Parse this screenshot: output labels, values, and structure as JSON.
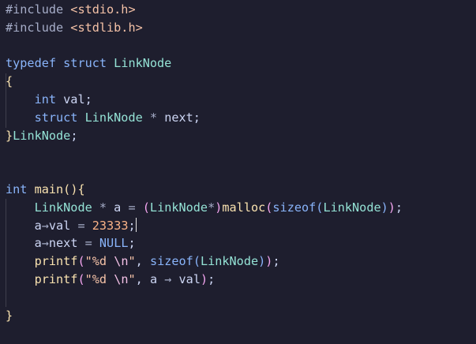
{
  "colors": {
    "background": "#1e1e2e",
    "preprocessor": "#a6adc8",
    "string": "#f5c2a7",
    "keyword": "#89b4fa",
    "type": "#94e2d5",
    "identifier": "#cdd6f4",
    "function": "#f9e2af",
    "number": "#fab387",
    "bracket_1": "#f9e2af",
    "bracket_2": "#f5a6f1",
    "bracket_3": "#89b4fa"
  },
  "editor": {
    "cursor_line": 12,
    "lines": [
      [
        {
          "t": "#include ",
          "c": "s-pre"
        },
        {
          "t": "<stdio.h>",
          "c": "s-str"
        }
      ],
      [
        {
          "t": "#include ",
          "c": "s-pre"
        },
        {
          "t": "<stdlib.h>",
          "c": "s-str"
        }
      ],
      [],
      [
        {
          "t": "typedef ",
          "c": "s-kw"
        },
        {
          "t": "struct ",
          "c": "s-kw"
        },
        {
          "t": "LinkNode",
          "c": "s-type"
        }
      ],
      [
        {
          "t": "{",
          "c": "s-brace1"
        }
      ],
      [
        {
          "t": "    "
        },
        {
          "t": "int ",
          "c": "s-kw"
        },
        {
          "t": "val",
          "c": "s-var"
        },
        {
          "t": ";",
          "c": "s-punc"
        }
      ],
      [
        {
          "t": "    "
        },
        {
          "t": "struct ",
          "c": "s-kw"
        },
        {
          "t": "LinkNode ",
          "c": "s-type"
        },
        {
          "t": "* ",
          "c": "s-op"
        },
        {
          "t": "next",
          "c": "s-var"
        },
        {
          "t": ";",
          "c": "s-punc"
        }
      ],
      [
        {
          "t": "}",
          "c": "s-brace1"
        },
        {
          "t": "LinkNode",
          "c": "s-type"
        },
        {
          "t": ";",
          "c": "s-punc"
        }
      ],
      [],
      [],
      [
        {
          "t": "int ",
          "c": "s-kw"
        },
        {
          "t": "main",
          "c": "s-fn"
        },
        {
          "t": "(",
          "c": "s-brace1"
        },
        {
          "t": ")",
          "c": "s-brace1"
        },
        {
          "t": "{",
          "c": "s-brace1"
        }
      ],
      [
        {
          "t": "    "
        },
        {
          "t": "LinkNode ",
          "c": "s-type"
        },
        {
          "t": "* ",
          "c": "s-op"
        },
        {
          "t": "a ",
          "c": "s-var"
        },
        {
          "t": "= ",
          "c": "s-op"
        },
        {
          "t": "(",
          "c": "s-brace2"
        },
        {
          "t": "LinkNode",
          "c": "s-type"
        },
        {
          "t": "*",
          "c": "s-op"
        },
        {
          "t": ")",
          "c": "s-brace2"
        },
        {
          "t": "malloc",
          "c": "s-fn"
        },
        {
          "t": "(",
          "c": "s-brace2"
        },
        {
          "t": "sizeof",
          "c": "s-kw"
        },
        {
          "t": "(",
          "c": "s-brace3"
        },
        {
          "t": "LinkNode",
          "c": "s-type"
        },
        {
          "t": ")",
          "c": "s-brace3"
        },
        {
          "t": ")",
          "c": "s-brace2"
        },
        {
          "t": ";",
          "c": "s-punc"
        }
      ],
      [
        {
          "t": "    "
        },
        {
          "t": "a",
          "c": "s-var"
        },
        {
          "t": "→",
          "c": "s-op"
        },
        {
          "t": "val ",
          "c": "s-var"
        },
        {
          "t": "= ",
          "c": "s-op"
        },
        {
          "t": "23333",
          "c": "s-num"
        },
        {
          "t": ";",
          "c": "s-punc"
        }
      ],
      [
        {
          "t": "    "
        },
        {
          "t": "a",
          "c": "s-var"
        },
        {
          "t": "→",
          "c": "s-op"
        },
        {
          "t": "next ",
          "c": "s-var"
        },
        {
          "t": "= ",
          "c": "s-op"
        },
        {
          "t": "NULL",
          "c": "s-const"
        },
        {
          "t": ";",
          "c": "s-punc"
        }
      ],
      [
        {
          "t": "    "
        },
        {
          "t": "printf",
          "c": "s-fn"
        },
        {
          "t": "(",
          "c": "s-brace2"
        },
        {
          "t": "\"%d ",
          "c": "s-str"
        },
        {
          "t": "\\n",
          "c": "s-esc"
        },
        {
          "t": "\"",
          "c": "s-str"
        },
        {
          "t": ", ",
          "c": "s-punc"
        },
        {
          "t": "sizeof",
          "c": "s-kw"
        },
        {
          "t": "(",
          "c": "s-brace3"
        },
        {
          "t": "LinkNode",
          "c": "s-type"
        },
        {
          "t": ")",
          "c": "s-brace3"
        },
        {
          "t": ")",
          "c": "s-brace2"
        },
        {
          "t": ";",
          "c": "s-punc"
        }
      ],
      [
        {
          "t": "    "
        },
        {
          "t": "printf",
          "c": "s-fn"
        },
        {
          "t": "(",
          "c": "s-brace2"
        },
        {
          "t": "\"%d ",
          "c": "s-str"
        },
        {
          "t": "\\n",
          "c": "s-esc"
        },
        {
          "t": "\"",
          "c": "s-str"
        },
        {
          "t": ", ",
          "c": "s-punc"
        },
        {
          "t": "a ",
          "c": "s-var"
        },
        {
          "t": "→ ",
          "c": "s-op"
        },
        {
          "t": "val",
          "c": "s-var"
        },
        {
          "t": ")",
          "c": "s-brace2"
        },
        {
          "t": ";",
          "c": "s-punc"
        }
      ],
      [],
      [
        {
          "t": "}",
          "c": "s-brace1"
        }
      ]
    ]
  }
}
